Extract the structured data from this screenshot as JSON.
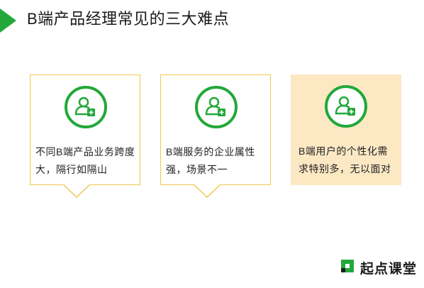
{
  "title": "B端产品经理常见的三大难点",
  "colors": {
    "accent": "#22a83a",
    "border": "#f0c84a",
    "fill": "#fde8c4"
  },
  "cards": [
    {
      "icon": "add-user-icon",
      "text": "不同B端产品业务跨度大，隔行如隔山"
    },
    {
      "icon": "add-user-icon",
      "text": "B端服务的企业属性强，场景不一"
    },
    {
      "icon": "add-user-icon",
      "text": "B端用户的个性化需求特别多，无以面对"
    }
  ],
  "brand": {
    "name": "起点课堂",
    "icon": "brand-logo-icon"
  }
}
